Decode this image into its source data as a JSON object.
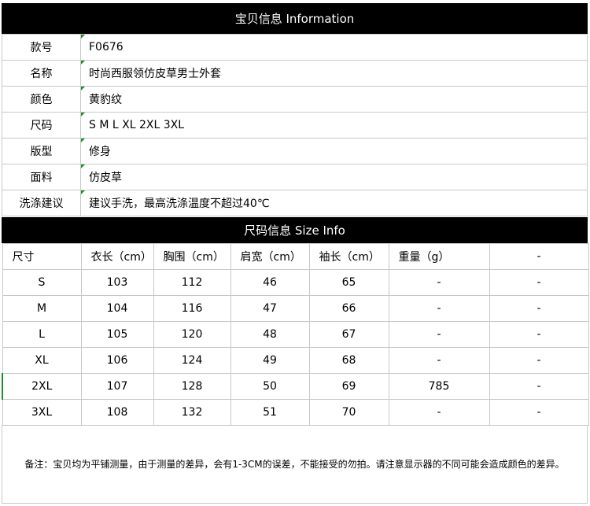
{
  "info_header": "宝贝信息  Information",
  "info_rows": [
    {
      "label": "款号",
      "value": "F0676"
    },
    {
      "label": "名称",
      "value": "时尚西服领仿皮草男士外套"
    },
    {
      "label": "颜色",
      "value": "黄豹纹"
    },
    {
      "label": "尺码",
      "value": "S M L XL 2XL  3XL"
    },
    {
      "label": "版型",
      "value": "修身"
    },
    {
      "label": "面料",
      "value": "仿皮草"
    },
    {
      "label": "洗涤建议",
      "value": "建议手洗，最高洗涤温度不超过40℃"
    }
  ],
  "size_header": "尺码信息  Size Info",
  "size_columns": [
    "尺寸",
    "衣长（cm）",
    "胸围（cm）",
    "肩宽（cm）",
    "袖长（cm）",
    "重量（g）",
    "-"
  ],
  "size_rows": [
    [
      "S",
      "103",
      "112",
      "46",
      "65",
      "-",
      "-"
    ],
    [
      "M",
      "104",
      "116",
      "47",
      "66",
      "-",
      "-"
    ],
    [
      "L",
      "105",
      "120",
      "48",
      "67",
      "-",
      "-"
    ],
    [
      "XL",
      "106",
      "124",
      "49",
      "68",
      "-",
      "-"
    ],
    [
      "2XL",
      "107",
      "128",
      "50",
      "69",
      "785",
      "-"
    ],
    [
      "3XL",
      "108",
      "132",
      "51",
      "70",
      "-",
      "-"
    ]
  ],
  "note": "备注：宝贝均为平铺测量，由于测量的差异，会有1-3CM的误差，不能接受的勿拍。请注意显示器的不同可能会造成颜色的差异。",
  "colors": {
    "header_bg": "#000000",
    "header_text": "#ffffff",
    "accent": "#1f8f2a",
    "border": "#c8c8c8"
  }
}
